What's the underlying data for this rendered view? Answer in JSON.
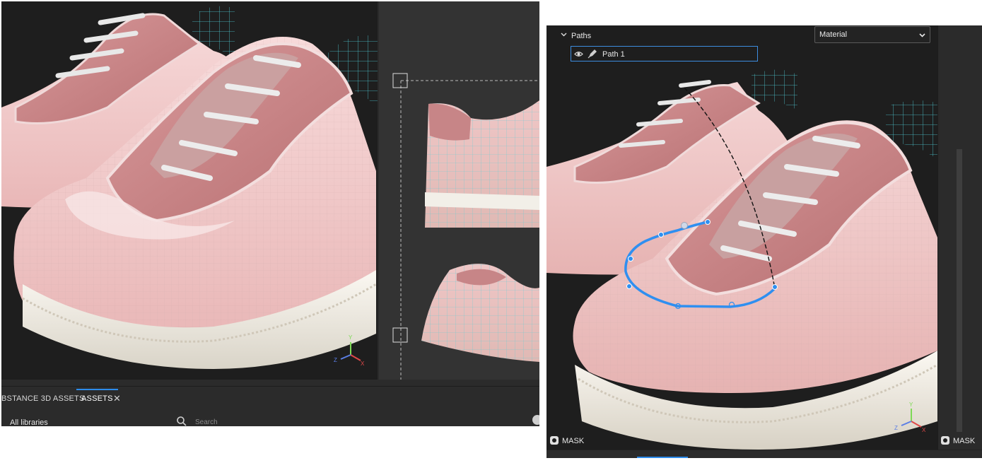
{
  "left_window": {
    "tabs": [
      {
        "label": "BSTANCE 3D ASSETS"
      },
      {
        "label": "ASSETS"
      }
    ],
    "close_glyph": "✕",
    "library_label": "All libraries",
    "search": {
      "placeholder": "Search",
      "value": ""
    },
    "axis_labels": {
      "x": "X",
      "y": "Y",
      "z": "Z"
    }
  },
  "right_window": {
    "paths_section": {
      "title": "Paths"
    },
    "path_item": {
      "label": "Path 1"
    },
    "material_select": {
      "selected": "Material"
    },
    "mask_left": "MASK",
    "mask_right": "MASK",
    "axis_labels": {
      "x": "X",
      "y": "Y",
      "z": "Z"
    }
  },
  "colors": {
    "accent": "#2d8ceb",
    "viewport_bg": "#1e1e1e",
    "panel_bg": "#2b2b2b",
    "shoe_pink": "#f2c9c9",
    "shoe_rose": "#c98587",
    "sole_white": "#f4f1ea",
    "mesh_teal": "#4ecfd7",
    "path_blue": "#2f8ff0"
  },
  "icons": [
    "close-icon",
    "search-icon",
    "eye-icon",
    "pen-icon",
    "chevron-down-icon",
    "mask-icon",
    "axis-gizmo-icon"
  ]
}
